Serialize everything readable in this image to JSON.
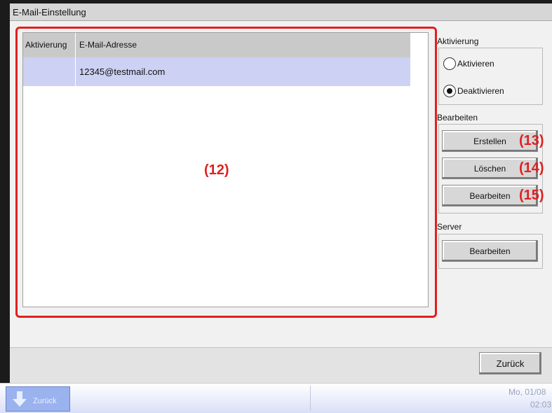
{
  "window": {
    "title": "E-Mail-Einstellung"
  },
  "table": {
    "headers": [
      "Aktivierung",
      "E-Mail-Adresse"
    ],
    "rows": [
      {
        "activation": "",
        "email": "12345@testmail.com"
      }
    ]
  },
  "activation": {
    "label": "Aktivierung",
    "options": [
      "Aktivieren",
      "Deaktivieren"
    ],
    "selected": "Deaktivieren"
  },
  "edit": {
    "label": "Bearbeiten",
    "buttons": {
      "create": "Erstellen",
      "delete": "Löschen",
      "edit": "Bearbeiten"
    }
  },
  "server": {
    "label": "Server",
    "edit_button": "Bearbeiten"
  },
  "footer": {
    "back_button": "Zurück"
  },
  "callouts": {
    "list": "(12)",
    "create": "(13)",
    "delete": "(14)",
    "edit": "(15)"
  },
  "taskbar": {
    "left_label": "Zurück",
    "date": "Mo, 01/08",
    "time": "02:03"
  },
  "colors": {
    "callout": "#e02020",
    "selected_row": "#cdd1f3",
    "header": "#c9c9c9"
  }
}
